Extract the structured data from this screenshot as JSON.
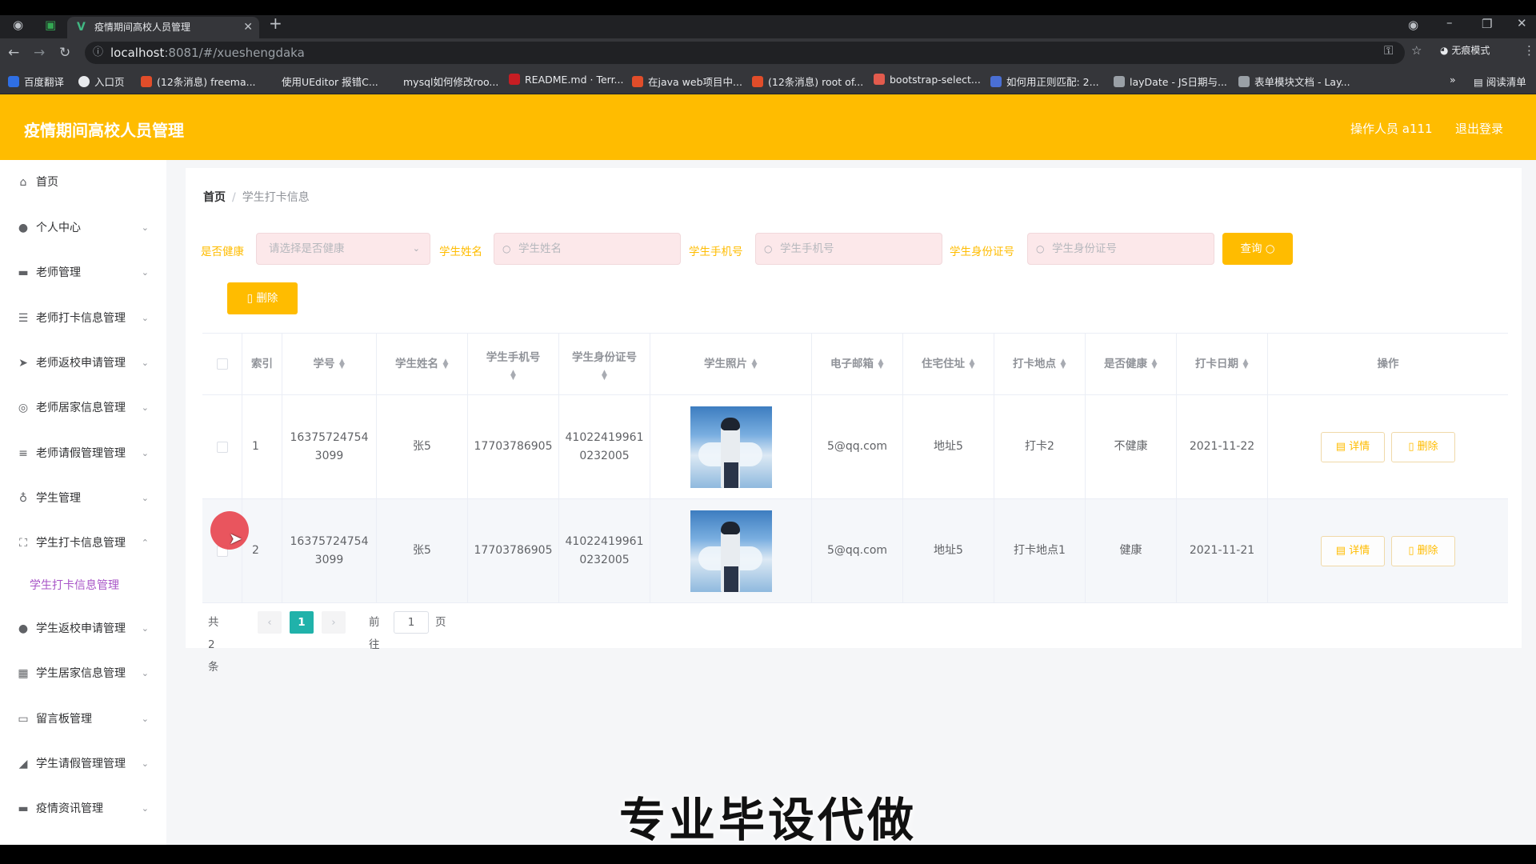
{
  "browser": {
    "tab_title": "疫情期间高校人员管理",
    "url_host": "localhost",
    "url_path": ":8081/#/xueshengdaka",
    "profile_label": "无痕模式",
    "bookmarks": [
      {
        "label": "百度翻译",
        "color": "#2f6fe4"
      },
      {
        "label": "入口页",
        "color": "#e8eaed"
      },
      {
        "label": "(12条消息) freema...",
        "color": "#e14d2a"
      },
      {
        "label": "使用UEditor 报错C...",
        "color": "#35363a"
      },
      {
        "label": "mysql如何修改roo...",
        "color": "#35363a"
      },
      {
        "label": "README.md · Terr...",
        "color": "#c71d23"
      },
      {
        "label": "在java web项目中...",
        "color": "#e14d2a"
      },
      {
        "label": "(12条消息) root of...",
        "color": "#e14d2a"
      },
      {
        "label": "bootstrap-select...",
        "color": "#e25b4d"
      },
      {
        "label": "如何用正则匹配: 2...",
        "color": "#4a6fd4"
      },
      {
        "label": "layDate - JS日期与...",
        "color": "#9aa0a6"
      },
      {
        "label": "表单模块文档 - Lay...",
        "color": "#9aa0a6"
      }
    ],
    "reading_mode": "阅读清单"
  },
  "header": {
    "title": "疫情期间高校人员管理",
    "operator": "操作人员 a111",
    "logout": "退出登录"
  },
  "sidebar": {
    "items": [
      {
        "label": "首页",
        "icon": "home-icon",
        "glyph": "⌂",
        "chevron": ""
      },
      {
        "label": "个人中心",
        "icon": "user-icon",
        "glyph": "●",
        "chevron": "⌄"
      },
      {
        "label": "老师管理",
        "icon": "monitor-icon",
        "glyph": "▬",
        "chevron": "⌄"
      },
      {
        "label": "老师打卡信息管理",
        "icon": "sliders-icon",
        "glyph": "☰",
        "chevron": "⌄"
      },
      {
        "label": "老师返校申请管理",
        "icon": "send-icon",
        "glyph": "➤",
        "chevron": "⌄"
      },
      {
        "label": "老师居家信息管理",
        "icon": "globe-icon",
        "glyph": "◎",
        "chevron": "⌄"
      },
      {
        "label": "老师请假管理管理",
        "icon": "list-icon",
        "glyph": "≡",
        "chevron": "⌄"
      },
      {
        "label": "学生管理",
        "icon": "mic-icon",
        "glyph": "♁",
        "chevron": "⌄"
      },
      {
        "label": "学生打卡信息管理",
        "icon": "fullscreen-icon",
        "glyph": "⛶",
        "chevron": "⌃"
      },
      {
        "label": "学生返校申请管理",
        "icon": "user-icon",
        "glyph": "●",
        "chevron": "⌄"
      },
      {
        "label": "学生居家信息管理",
        "icon": "grid-icon",
        "glyph": "▦",
        "chevron": "⌄"
      },
      {
        "label": "留言板管理",
        "icon": "message-icon",
        "glyph": "▭",
        "chevron": "⌄"
      },
      {
        "label": "学生请假管理管理",
        "icon": "notice-icon",
        "glyph": "◢",
        "chevron": "⌄"
      },
      {
        "label": "疫情资讯管理",
        "icon": "desktop-icon",
        "glyph": "▬",
        "chevron": "⌄"
      }
    ],
    "submenu": {
      "label": "学生打卡信息管理"
    }
  },
  "breadcrumb": {
    "home": "首页",
    "current": "学生打卡信息"
  },
  "filters": {
    "health_label": "是否健康",
    "health_placeholder": "请选择是否健康",
    "name_label": "学生姓名",
    "name_placeholder": "学生姓名",
    "phone_label": "学生手机号",
    "phone_placeholder": "学生手机号",
    "idcard_label": "学生身份证号",
    "idcard_placeholder": "学生身份证号",
    "query_button": "查询",
    "delete_button": "删除"
  },
  "table": {
    "headers": {
      "index": "索引",
      "xuehao": "学号",
      "name": "学生姓名",
      "phone": "学生手机号",
      "idcard": "学生身份证号",
      "photo": "学生照片",
      "email": "电子邮箱",
      "address": "住宅住址",
      "place": "打卡地点",
      "health": "是否健康",
      "date": "打卡日期",
      "ops": "操作"
    },
    "rows": [
      {
        "index": "1",
        "xuehao_a": "16375724754",
        "xuehao_b": "3099",
        "name": "张5",
        "phone": "17703786905",
        "idcard_a": "41022419961",
        "idcard_b": "0232005",
        "email": "5@qq.com",
        "address": "地址5",
        "place": "打卡2",
        "health": "不健康",
        "date": "2021-11-22"
      },
      {
        "index": "2",
        "xuehao_a": "16375724754",
        "xuehao_b": "3099",
        "name": "张5",
        "phone": "17703786905",
        "idcard_a": "41022419961",
        "idcard_b": "0232005",
        "email": "5@qq.com",
        "address": "地址5",
        "place": "打卡地点1",
        "health": "健康",
        "date": "2021-11-21"
      }
    ],
    "detail_label": "详情",
    "delete_label": "删除"
  },
  "pagination": {
    "total": "共 2 条",
    "current_page": "1",
    "goto_label": "前往",
    "goto_value": "1",
    "page_suffix": "页"
  },
  "watermark": "专业毕设代做",
  "colors": {
    "accent": "#ffbc00",
    "active_page": "#20b2aa",
    "submenu_active": "#a855c7"
  }
}
